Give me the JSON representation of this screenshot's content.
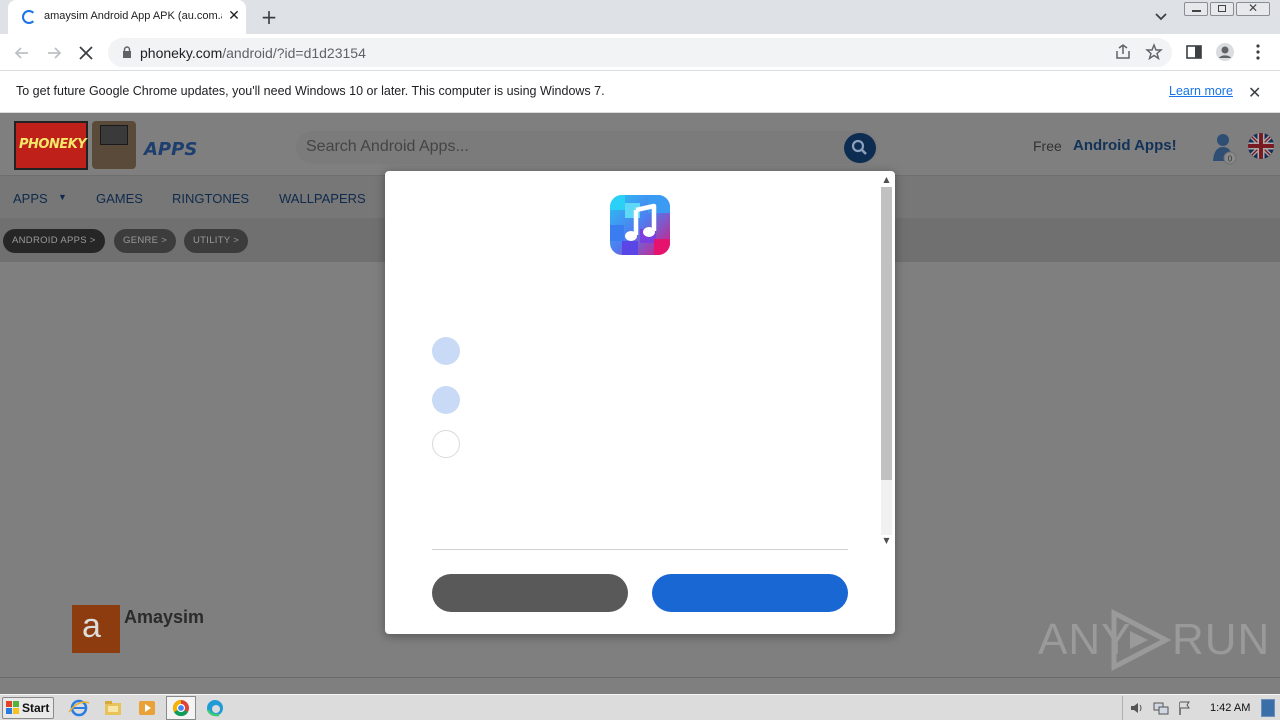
{
  "browser": {
    "tab_title": "amaysim Android App APK (au.com.a",
    "url_domain": "phoneky.com",
    "url_path": "/android/?id=d1d23154",
    "infobar_text": "To get future Google Chrome updates, you'll need Windows 10 or later. This computer is using Windows 7.",
    "infobar_link": "Learn more"
  },
  "site": {
    "logo_text": "PHONEKY",
    "logo_apps": "APPS",
    "search_placeholder": "Search Android Apps...",
    "free_label": "Free",
    "android_apps_label": "Android Apps!",
    "user_count": "0",
    "nav": [
      "APPS",
      "GAMES",
      "RINGTONES",
      "WALLPAPERS"
    ],
    "breadcrumbs": [
      "ANDROID APPS >",
      "GENRE >",
      "UTILITY >"
    ],
    "app_name": "Amaysim",
    "app_logo_letter": "a"
  },
  "modal": {
    "icon": "music-note-app-icon",
    "radios": [
      {
        "state": "selected"
      },
      {
        "state": "selected"
      },
      {
        "state": "unselected"
      }
    ]
  },
  "watermark": {
    "left": "ANY",
    "right": "RUN"
  },
  "taskbar": {
    "start_label": "Start",
    "clock": "1:42 AM"
  },
  "colors": {
    "accent": "#1967d2",
    "secondary_button": "#595959",
    "radio_selected": "#c9daf6"
  }
}
